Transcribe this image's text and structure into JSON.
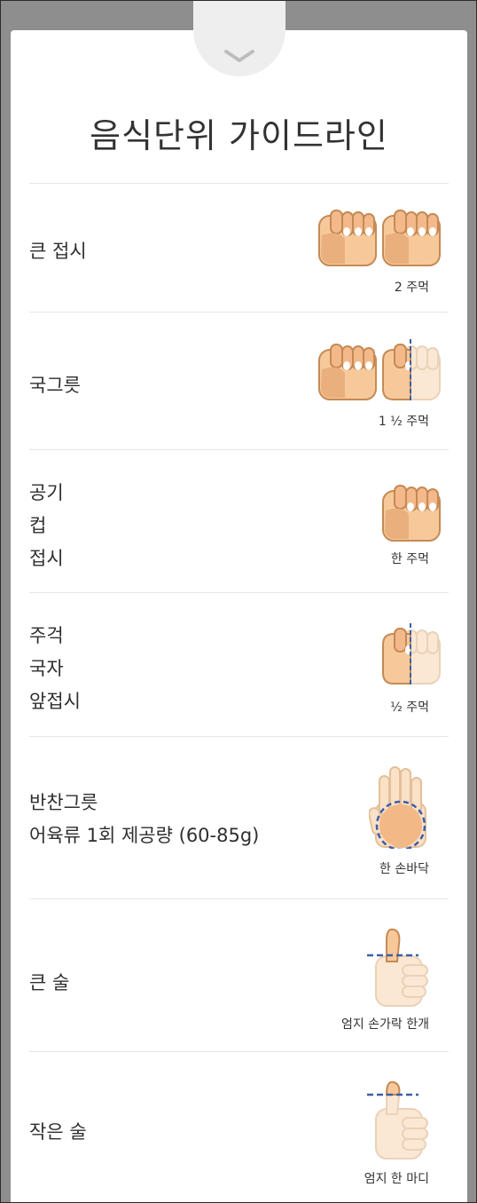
{
  "title": "음식단위 가이드라인",
  "colors": {
    "skin": "#f7c99a",
    "skin_dark": "#e0a876",
    "skin_light": "#fbe8d4",
    "outline": "#c58a55",
    "nail": "#ffffff",
    "dash": "#3b5ea8",
    "divider": "#e6e6e6"
  },
  "rows": [
    {
      "lines": [
        "큰 접시"
      ],
      "caption": "2 주먹",
      "visual": "two-fists"
    },
    {
      "lines": [
        "국그릇"
      ],
      "caption": "1 ½ 주먹",
      "visual": "one-and-half-fist"
    },
    {
      "lines": [
        "공기",
        "컵",
        "접시"
      ],
      "caption": "한 주먹",
      "visual": "one-fist"
    },
    {
      "lines": [
        "주걱",
        "국자",
        "앞접시"
      ],
      "caption": "½ 주먹",
      "visual": "half-fist"
    },
    {
      "lines": [
        "반찬그릇",
        "어육류 1회 제공량 (60-85g)"
      ],
      "caption": "한 손바닥",
      "visual": "palm"
    },
    {
      "lines": [
        "큰 술"
      ],
      "caption": "엄지 손가락 한개",
      "visual": "thumb-whole"
    },
    {
      "lines": [
        "작은 술"
      ],
      "caption": "엄지 한 마디",
      "visual": "thumb-tip"
    }
  ]
}
